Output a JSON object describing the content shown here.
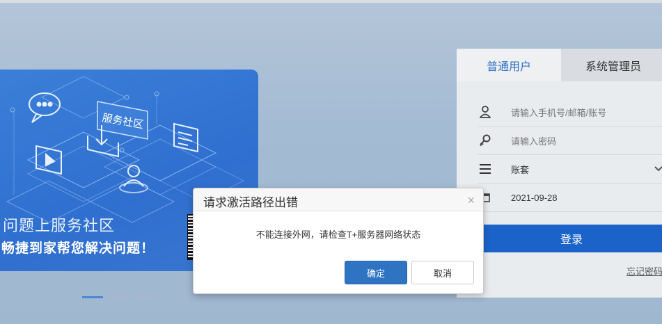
{
  "banner": {
    "badge_label": "服务社区",
    "line1": "问题上服务社区",
    "line2": "畅捷到家帮您解决问题！",
    "icons": [
      "chat-bubble-icon",
      "download-icon",
      "document-icon",
      "play-icon",
      "user-icon"
    ]
  },
  "carousel": {
    "slides": 3,
    "active": 0
  },
  "login": {
    "tabs": [
      {
        "label": "普通用户",
        "active": true
      },
      {
        "label": "系统管理员",
        "active": false
      }
    ],
    "username_placeholder": "请输入手机号/邮箱/账号",
    "password_placeholder": "请输入密码",
    "account_set_label": "账套",
    "date_value": "2021-09-28",
    "login_button": "登录",
    "forgot_link": "忘记密码"
  },
  "modal": {
    "title": "请求激活路径出错",
    "close_glyph": "×",
    "message": "不能连接外网，请检查T+服务器网络状态",
    "ok_label": "确定",
    "cancel_label": "取消"
  },
  "colors": {
    "accent": "#1b63c9",
    "banner_blue": "#2f6fcf",
    "ok_button": "#2e74c2",
    "tab_active_text": "#2e6fc6"
  }
}
